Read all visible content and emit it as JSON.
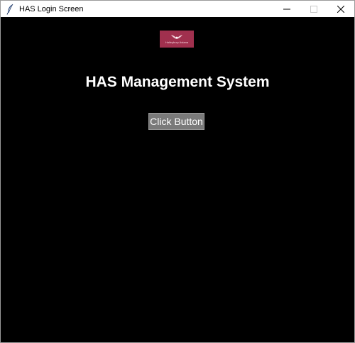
{
  "window": {
    "title": "HAS Login Screen",
    "controls": {
      "minimize_icon": "minimize-icon",
      "maximize_icon": "maximize-icon",
      "close_icon": "close-icon"
    },
    "app_icon": "feather-icon"
  },
  "content": {
    "logo": {
      "text": "Haileybury Astana",
      "background": "#a0304e"
    },
    "heading": "HAS Management System",
    "button_label": "Click Button",
    "background": "#000000"
  }
}
